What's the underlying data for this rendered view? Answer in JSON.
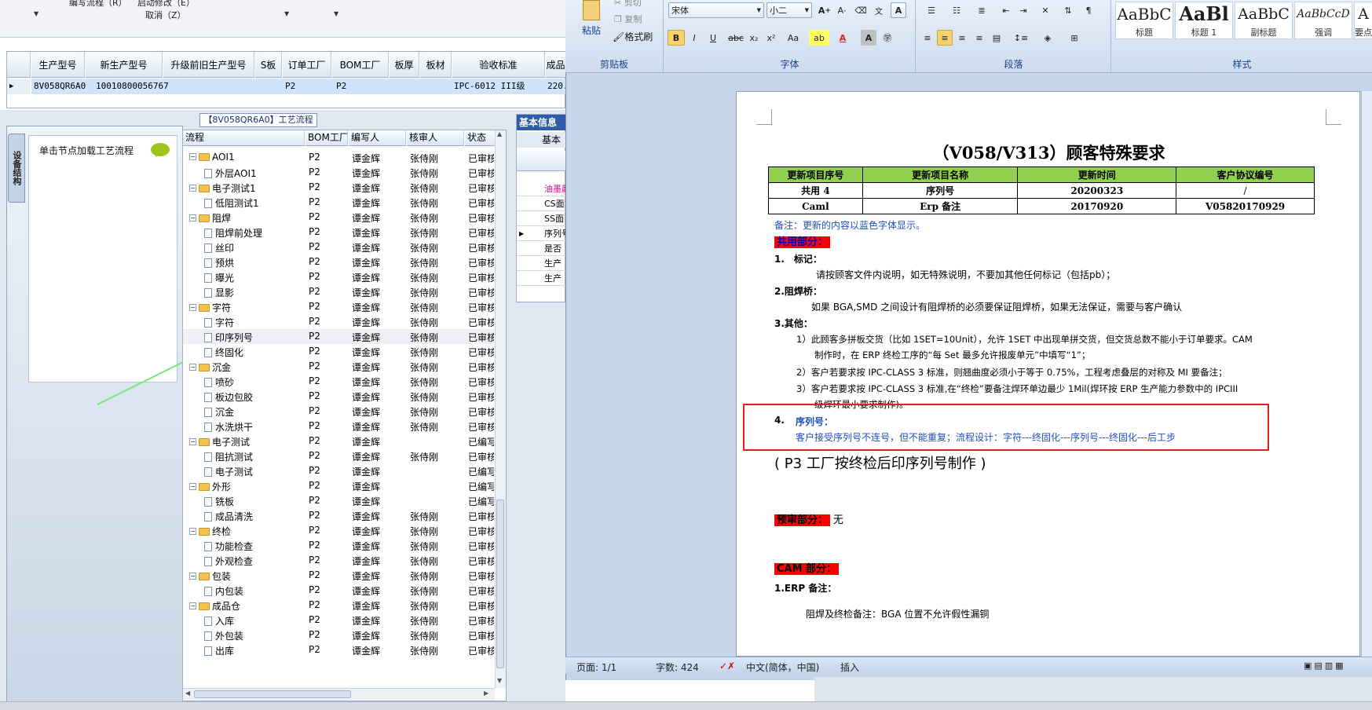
{
  "erp": {
    "toolbar": {
      "item1": "编写流程（R）",
      "item2": "启动修改（E）",
      "item3": "取消（Z）"
    },
    "product_grid": {
      "columns": [
        "生产型号",
        "新生产型号",
        "升级前旧生产型号",
        "S板",
        "订单工厂",
        "BOM工厂",
        "板厚",
        "板材",
        "验收标准",
        "成品"
      ],
      "row": [
        "8V058QR6A0",
        "10010800056767",
        "",
        "",
        "P2",
        "P2",
        "",
        "",
        "IPC-6012 III级",
        "220.0"
      ]
    },
    "workflow_title": "【8V058QR6A0】工艺流程",
    "side_tab": "设备结构",
    "load_hint": "单击节点加载工艺流程",
    "tree_columns": [
      "流程",
      "BOM工厂",
      "编写人",
      "核审人",
      "状态"
    ],
    "tree_rows": [
      {
        "level": 1,
        "name": "AOI1",
        "bom": "P2",
        "author": "谭金辉",
        "reviewer": "张侍刚",
        "status": "已审核"
      },
      {
        "level": 2,
        "name": "外层AOI1",
        "bom": "P2",
        "author": "谭金辉",
        "reviewer": "张侍刚",
        "status": "已审核"
      },
      {
        "level": 1,
        "name": "电子测试1",
        "bom": "P2",
        "author": "谭金辉",
        "reviewer": "张侍刚",
        "status": "已审核"
      },
      {
        "level": 2,
        "name": "低阻测试1",
        "bom": "P2",
        "author": "谭金辉",
        "reviewer": "张侍刚",
        "status": "已审核"
      },
      {
        "level": 1,
        "name": "阻焊",
        "bom": "P2",
        "author": "谭金辉",
        "reviewer": "张侍刚",
        "status": "已审核"
      },
      {
        "level": 2,
        "name": "阻焊前处理",
        "bom": "P2",
        "author": "谭金辉",
        "reviewer": "张侍刚",
        "status": "已审核"
      },
      {
        "level": 2,
        "name": "丝印",
        "bom": "P2",
        "author": "谭金辉",
        "reviewer": "张侍刚",
        "status": "已审核"
      },
      {
        "level": 2,
        "name": "预烘",
        "bom": "P2",
        "author": "谭金辉",
        "reviewer": "张侍刚",
        "status": "已审核"
      },
      {
        "level": 2,
        "name": "曝光",
        "bom": "P2",
        "author": "谭金辉",
        "reviewer": "张侍刚",
        "status": "已审核"
      },
      {
        "level": 2,
        "name": "显影",
        "bom": "P2",
        "author": "谭金辉",
        "reviewer": "张侍刚",
        "status": "已审核"
      },
      {
        "level": 1,
        "name": "字符",
        "bom": "P2",
        "author": "谭金辉",
        "reviewer": "张侍刚",
        "status": "已审核"
      },
      {
        "level": 2,
        "name": "字符",
        "bom": "P2",
        "author": "谭金辉",
        "reviewer": "张侍刚",
        "status": "已审核"
      },
      {
        "level": 2,
        "name": "印序列号",
        "bom": "P2",
        "author": "谭金辉",
        "reviewer": "张侍刚",
        "status": "已审核",
        "selected": true
      },
      {
        "level": 2,
        "name": "终固化",
        "bom": "P2",
        "author": "谭金辉",
        "reviewer": "张侍刚",
        "status": "已审核"
      },
      {
        "level": 1,
        "name": "沉金",
        "bom": "P2",
        "author": "谭金辉",
        "reviewer": "张侍刚",
        "status": "已审核"
      },
      {
        "level": 2,
        "name": "喷砂",
        "bom": "P2",
        "author": "谭金辉",
        "reviewer": "张侍刚",
        "status": "已审核"
      },
      {
        "level": 2,
        "name": "板边包胶",
        "bom": "P2",
        "author": "谭金辉",
        "reviewer": "张侍刚",
        "status": "已审核"
      },
      {
        "level": 2,
        "name": "沉金",
        "bom": "P2",
        "author": "谭金辉",
        "reviewer": "张侍刚",
        "status": "已审核"
      },
      {
        "level": 2,
        "name": "水洗烘干",
        "bom": "P2",
        "author": "谭金辉",
        "reviewer": "张侍刚",
        "status": "已审核"
      },
      {
        "level": 1,
        "name": "电子测试",
        "bom": "P2",
        "author": "谭金辉",
        "reviewer": "",
        "status": "已编写"
      },
      {
        "level": 2,
        "name": "阻抗测试",
        "bom": "P2",
        "author": "谭金辉",
        "reviewer": "张侍刚",
        "status": "已审核"
      },
      {
        "level": 2,
        "name": "电子测试",
        "bom": "P2",
        "author": "谭金辉",
        "reviewer": "",
        "status": "已编写"
      },
      {
        "level": 1,
        "name": "外形",
        "bom": "P2",
        "author": "谭金辉",
        "reviewer": "",
        "status": "已编写"
      },
      {
        "level": 2,
        "name": "铣板",
        "bom": "P2",
        "author": "谭金辉",
        "reviewer": "",
        "status": "已编写"
      },
      {
        "level": 2,
        "name": "成品清洗",
        "bom": "P2",
        "author": "谭金辉",
        "reviewer": "张侍刚",
        "status": "已审核"
      },
      {
        "level": 1,
        "name": "终检",
        "bom": "P2",
        "author": "谭金辉",
        "reviewer": "张侍刚",
        "status": "已审核"
      },
      {
        "level": 2,
        "name": "功能检查",
        "bom": "P2",
        "author": "谭金辉",
        "reviewer": "张侍刚",
        "status": "已审核"
      },
      {
        "level": 2,
        "name": "外观检查",
        "bom": "P2",
        "author": "谭金辉",
        "reviewer": "张侍刚",
        "status": "已审核"
      },
      {
        "level": 1,
        "name": "包装",
        "bom": "P2",
        "author": "谭金辉",
        "reviewer": "张侍刚",
        "status": "已审核"
      },
      {
        "level": 2,
        "name": "内包装",
        "bom": "P2",
        "author": "谭金辉",
        "reviewer": "张侍刚",
        "status": "已审核"
      },
      {
        "level": 1,
        "name": "成品仓",
        "bom": "P2",
        "author": "谭金辉",
        "reviewer": "张侍刚",
        "status": "已审核"
      },
      {
        "level": 2,
        "name": "入库",
        "bom": "P2",
        "author": "谭金辉",
        "reviewer": "张侍刚",
        "status": "已审核"
      },
      {
        "level": 2,
        "name": "外包装",
        "bom": "P2",
        "author": "谭金辉",
        "reviewer": "张侍刚",
        "status": "已审核"
      },
      {
        "level": 2,
        "name": "出库",
        "bom": "P2",
        "author": "谭金辉",
        "reviewer": "张侍刚",
        "status": "已审核"
      }
    ],
    "basic_info": {
      "tab1": "基本信息",
      "tab2": "基本",
      "rows": [
        "油墨颜",
        "CS面",
        "SS面",
        "序列号",
        "是否",
        "生产",
        "生产"
      ]
    }
  },
  "word": {
    "ribbon": {
      "paste": "粘贴",
      "cut": "剪切",
      "copy": "复制",
      "format_painter": "格式刷",
      "clipboard": "剪贴板",
      "font_name": "宋体",
      "font_size": "小二",
      "font_group": "字体",
      "paragraph_group": "段落",
      "styles_group": "样式",
      "styles": [
        {
          "sample": "AaBbC",
          "name": "标题"
        },
        {
          "sample": "AaBl",
          "name": "标题 1"
        },
        {
          "sample": "AaBbC",
          "name": "副标题"
        },
        {
          "sample": "AaBbCcD",
          "name": "强调"
        },
        {
          "sample": "A",
          "name": "要点"
        }
      ]
    },
    "doc": {
      "title": "（V058/V313）顾客特殊要求",
      "table_headers": [
        "更新项目序号",
        "更新项目名称",
        "更新时间",
        "客户协议编号"
      ],
      "table_rows": [
        [
          "共用 4",
          "序列号",
          "20200323",
          "/"
        ],
        [
          "Caml",
          "Erp 备注",
          "20170920",
          "V05820170929"
        ]
      ],
      "note": "备注：更新的内容以蓝色字体显示。",
      "common_section": "共用部分：",
      "item1_title": "1.　标记：",
      "item1_text": "请按顾客文件内说明，如无特殊说明，不要加其他任何标记（包括pb）；",
      "item2_title": "2.阻焊桥：",
      "item2_text": "如果 BGA,SMD 之间设计有阻焊桥的必须要保证阻焊桥，如果无法保证，需要与客户确认",
      "item3_title": "3.其他：",
      "item3_1a": "1）此顾客多拼板交货（比如 1SET=10Unit），允许 1SET 中出现单拼交货，但交货总数不能小于订单要求。CAM",
      "item3_1b": "制作时，在 ERP 终检工序的“每 Set 最多允许报废单元”中填写“1”；",
      "item3_2": "2）客户若要求按 IPC-CLASS 3 标准，则翘曲度必须小于等于 0.75%，工程考虑叠层的对称及 MI 要备注；",
      "item3_3a": "3）客户若要求按 IPC-CLASS 3 标准,在“终检”要备注焊环单边最少 1Mil(焊环按 ERP 生产能力参数中的 IPCIII",
      "item3_3b": "级焊环最小要求制作)。",
      "item4_num": "4.",
      "item4_title": "序列号：",
      "item4_text": "客户接受序列号不连号，但不能重复；流程设计：字符---终固化---序列号---终固化---后工步",
      "p3_note": "( P3 工厂按终检后印序列号制作 )",
      "pre_review": "预审部分：",
      "pre_review_value": "无",
      "cam_section": "CAM 部分：",
      "erp_note_title": "1.ERP 备注：",
      "erp_note_text": "阻焊及终检备注：BGA 位置不允许假性漏铜"
    },
    "status": {
      "page": "页面: 1/1",
      "words": "字数: 424",
      "lang": "中文(简体，中国)",
      "mode": "插入"
    }
  }
}
